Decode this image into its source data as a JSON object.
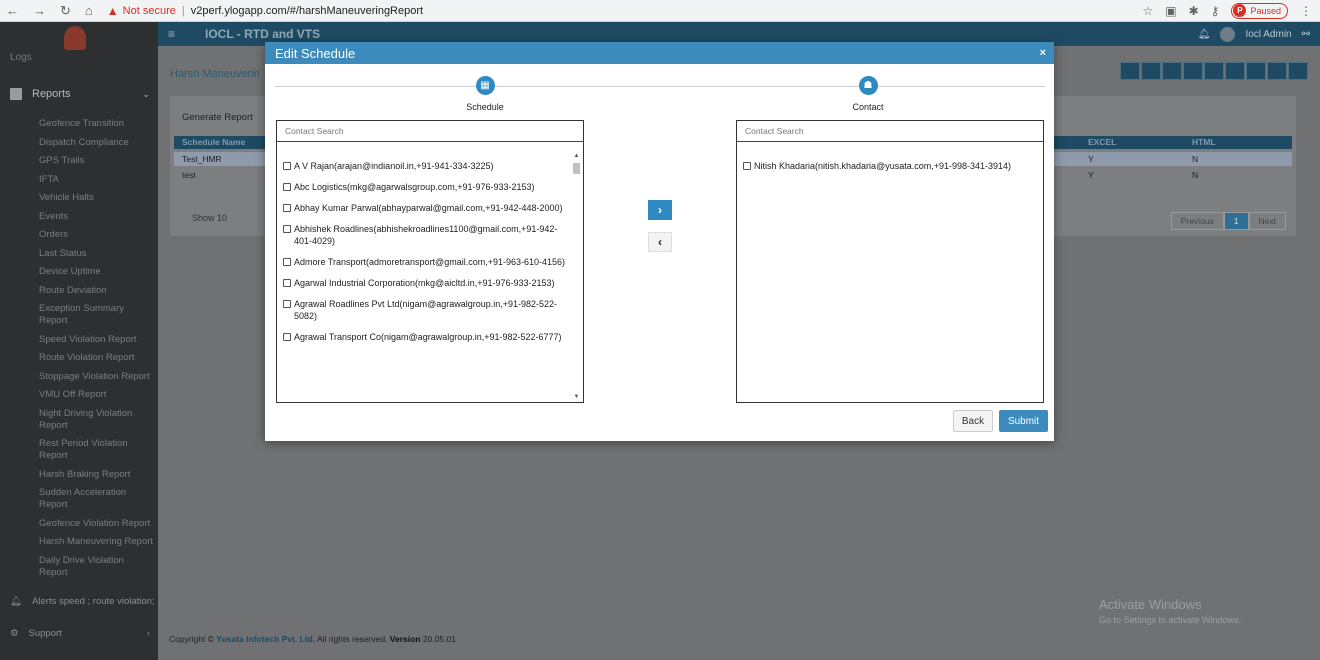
{
  "browser": {
    "not_secure": "Not secure",
    "url": "v2perf.ylogapp.com/#/harshManeuveringReport",
    "paused": "Paused",
    "profile_initial": "P"
  },
  "app": {
    "title": "IOCL - RTD and VTS",
    "user": "Iocl Admin"
  },
  "sidebar": {
    "logs": "Logs",
    "reports_label": "Reports",
    "report_items": [
      "Geofence Transition",
      "Dispatch Compliance",
      "GPS Trails",
      "IFTA",
      "Vehicle Halts",
      "Events",
      "Orders",
      "Last Status",
      "Device Uptime",
      "Route Deviation",
      "Exception Summary Report",
      "Speed Violation Report",
      "Route Violation Report",
      "Stoppage Violation Report",
      "VMU Off Report",
      "Night Driving Violation Report",
      "Rest Period Violation Report",
      "Harsh Braking Report",
      "Sudden Acceleration Report",
      "Geofence Violation Report",
      "Harsh Maneuvering Report",
      "Daily Drive Violation Report"
    ],
    "alerts": "Alerts speed ; route violation;",
    "support": "Support"
  },
  "main": {
    "page_title": "Harsh Maneuverin",
    "generate_report": "Generate Report",
    "table": {
      "col_schedule_name": "Schedule Name",
      "col_excel": "EXCEL",
      "col_html": "HTML",
      "rows": [
        {
          "name": "Test_HMR",
          "excel": "Y",
          "html": "N"
        },
        {
          "name": "test",
          "excel": "Y",
          "html": "N"
        }
      ]
    },
    "show_label": "Show",
    "show_value": "10",
    "pager": {
      "prev": "Previous",
      "current": "1",
      "next": "Next"
    },
    "footer_prefix": "Copyright ©",
    "footer_company": "Yusata Infotech Pvt. Ltd.",
    "footer_rights": "All rights reserved.",
    "footer_version_label": "Version",
    "footer_version": "20.05.01"
  },
  "watermark": {
    "line1": "Activate Windows",
    "line2": "Go to Settings to activate Windows."
  },
  "modal": {
    "title": "Edit Schedule",
    "close": "×",
    "steps": [
      {
        "label": "Schedule",
        "icon": "calendar-icon"
      },
      {
        "label": "Contact",
        "icon": "contact-icon"
      }
    ],
    "left_search_placeholder": "Contact Search",
    "right_search_placeholder": "Contact Search",
    "left_contacts": [
      "A V Rajan(arajan@indianoil.in,+91-941-334-3225)",
      "Abc Logistics(mkg@agarwalsgroup.com,+91-976-933-2153)",
      "Abhay Kumar Parwal(abhayparwal@gmail.com,+91-942-448-2000)",
      "Abhishek Roadlines(abhishekroadlines1100@gmail.com,+91-942-401-4029)",
      "Admore Transport(admoretransport@gmail.com,+91-963-610-4156)",
      "Agarwal Industrial Corporation(mkg@aicltd.in,+91-976-933-2153)",
      "Agrawal Roadlines Pvt Ltd(nigam@agrawalgroup.in,+91-982-522-5082)",
      "Agrawal Transport Co(nigam@agrawalgroup.in,+91-982-522-6777)"
    ],
    "right_contacts": [
      "Nitish Khadaria(nitish.khadaria@yusata.com,+91-998-341-3914)"
    ],
    "move_right": "›",
    "move_left": "‹",
    "back_label": "Back",
    "submit_label": "Submit",
    "colors": {
      "header": "#3d8bbd",
      "step_icon": "#2f8ac2",
      "submit": "#3d8bbd"
    }
  }
}
